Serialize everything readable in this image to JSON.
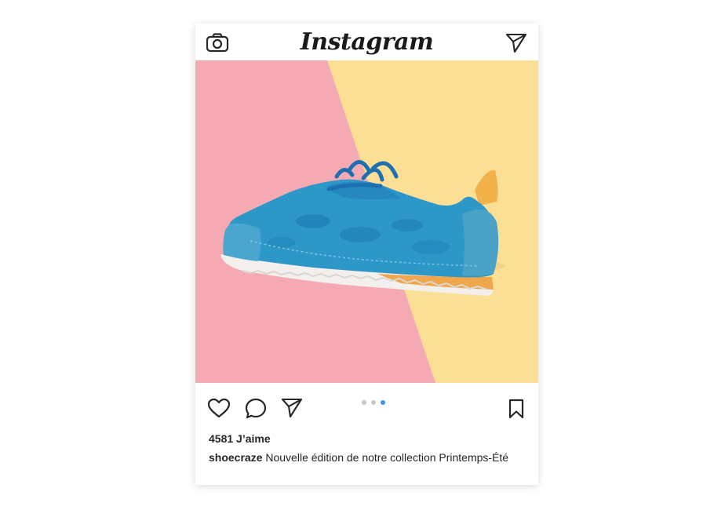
{
  "header": {
    "app_title": "Instagram",
    "camera_icon": "camera-icon",
    "direct_icon": "paper-plane-icon"
  },
  "post": {
    "image_alt": "Blue sneaker on pink and yellow background",
    "carousel": {
      "count": 3,
      "active_index": 2
    },
    "actions": {
      "like_icon": "heart-icon",
      "comment_icon": "comment-icon",
      "share_icon": "paper-plane-icon",
      "save_icon": "bookmark-icon"
    },
    "likes_text": "4581 J’aime",
    "caption_user": "shoecraze",
    "caption_text": " Nouvelle édition de notre collection Printemps-Été"
  },
  "colors": {
    "pink": "#f4a9b3",
    "yellow": "#fbdf95",
    "shoe_blue": "#2d97c8",
    "dot_active": "#3897f0",
    "dot_inactive": "#c7c7c7"
  }
}
